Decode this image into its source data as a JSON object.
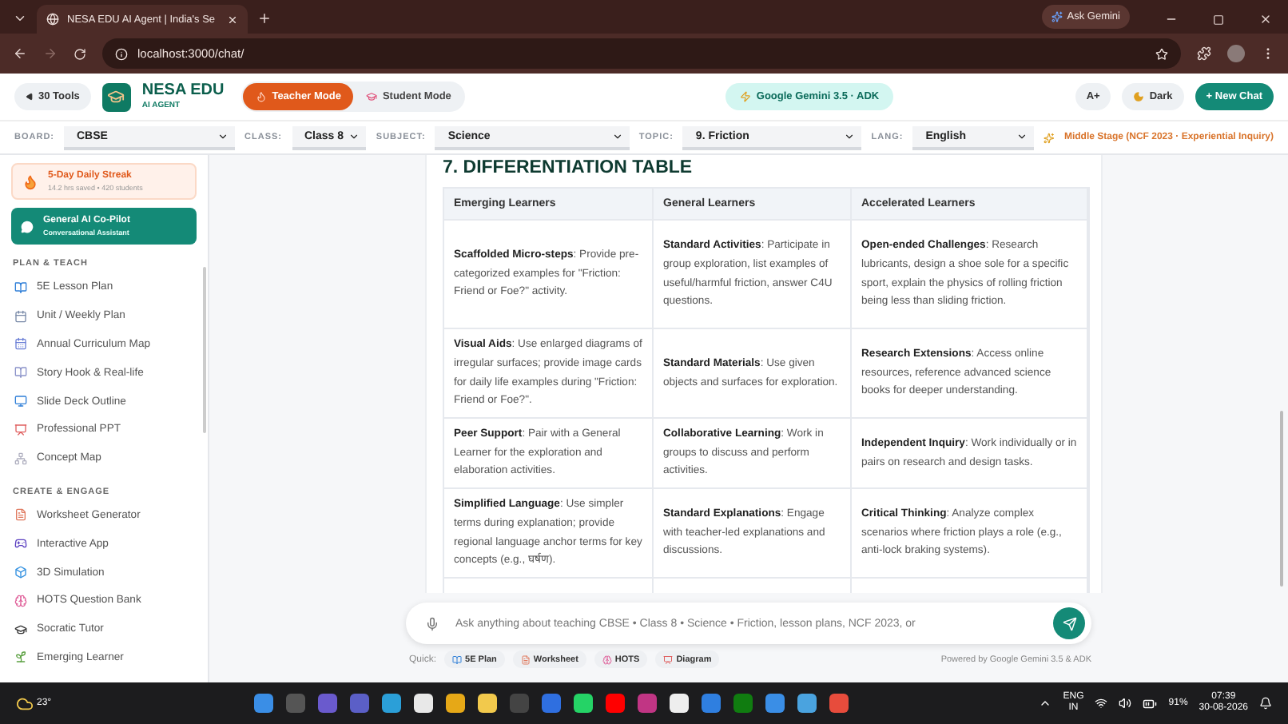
{
  "browser": {
    "tab_title": "NESA EDU AI Agent | India's Se",
    "url": "localhost:3000/chat/",
    "ask_button": "Ask Gemini"
  },
  "header": {
    "tools_button": "30 Tools",
    "brand": "NESA EDU",
    "brand_sub": "AI AGENT",
    "modes": [
      {
        "label": "Teacher Mode",
        "selected": true
      },
      {
        "label": "Student Mode",
        "selected": false
      }
    ],
    "model_badge": "Google Gemini 3.5 · ADK",
    "font_button": "A+",
    "theme_button": "Dark",
    "new_chat_button": "+ New Chat"
  },
  "filters": [
    {
      "label": "BOARD:",
      "value": "CBSE"
    },
    {
      "label": "CLASS:",
      "value": "Class 8"
    },
    {
      "label": "SUBJECT:",
      "value": "Science"
    },
    {
      "label": "TOPIC:",
      "value": "9. Friction"
    },
    {
      "label": "LANG:",
      "value": "English"
    }
  ],
  "stage_note": "Middle Stage (NCF 2023 · Experiential Inquiry)",
  "sidebar": {
    "streak": {
      "title": "5-Day Daily Streak",
      "subtitle": "14.2 hrs saved • 420 students"
    },
    "copilot": {
      "title": "General AI Co-Pilot",
      "subtitle": "Conversational Assistant"
    },
    "sections": [
      {
        "title": "PLAN & TEACH",
        "items": [
          "5E Lesson Plan",
          "Unit / Weekly Plan",
          "Annual Curriculum Map",
          "Story Hook & Real-life",
          "Slide Deck Outline",
          "Professional PPT",
          "Concept Map"
        ]
      },
      {
        "title": "CREATE & ENGAGE",
        "items": [
          "Worksheet Generator",
          "Interactive App",
          "3D Simulation",
          "HOTS Question Bank",
          "Socratic Tutor",
          "Emerging Learner"
        ]
      }
    ]
  },
  "content": {
    "heading": "7. DIFFERENTIATION TABLE",
    "columns": [
      "Emerging Learners",
      "General Learners",
      "Accelerated Learners"
    ],
    "rows": [
      [
        "**Scaffolded Micro-steps**: Provide pre-categorized examples for \"Friction: Friend or Foe?\" activity.",
        "**Standard Activities**: Participate in group exploration, list examples of useful/harmful friction, answer C4U questions.",
        "**Open-ended Challenges**: Research lubricants, design a shoe sole for a specific sport, explain the physics of rolling friction being less than sliding friction."
      ],
      [
        "**Visual Aids**: Use enlarged diagrams of irregular surfaces; provide image cards for daily life examples during \"Friction: Friend or Foe?\".",
        "**Standard Materials**: Use given objects and surfaces for exploration.",
        "**Research Extensions**: Access online resources, reference advanced science books for deeper understanding."
      ],
      [
        "**Peer Support**: Pair with a General Learner for the exploration and elaboration activities.",
        "**Collaborative Learning**: Work in groups to discuss and perform activities.",
        "**Independent Inquiry**: Work individually or in pairs on research and design tasks."
      ],
      [
        "**Simplified Language**: Use simpler terms during explanation; provide regional language anchor terms for key concepts (e.g., घर्षण).",
        "**Standard Explanations**: Engage with teacher-led explanations and discussions.",
        "**Critical Thinking**: Analyze complex scenarios where friction plays a role (e.g., anti-lock braking systems)."
      ]
    ]
  },
  "chat": {
    "placeholder": "Ask anything about teaching CBSE • Class 8 • Science • Friction, lesson plans, NCF 2023, or",
    "quick_label": "Quick:",
    "quick": [
      "5E Plan",
      "Worksheet",
      "HOTS",
      "Diagram"
    ],
    "powered": "Powered by Google Gemini 3.5 & ADK"
  },
  "taskbar": {
    "weather": "23°",
    "lang": "ENG",
    "region": "IN",
    "battery": "91%",
    "time": "07:39",
    "date": "30-08-2026"
  }
}
